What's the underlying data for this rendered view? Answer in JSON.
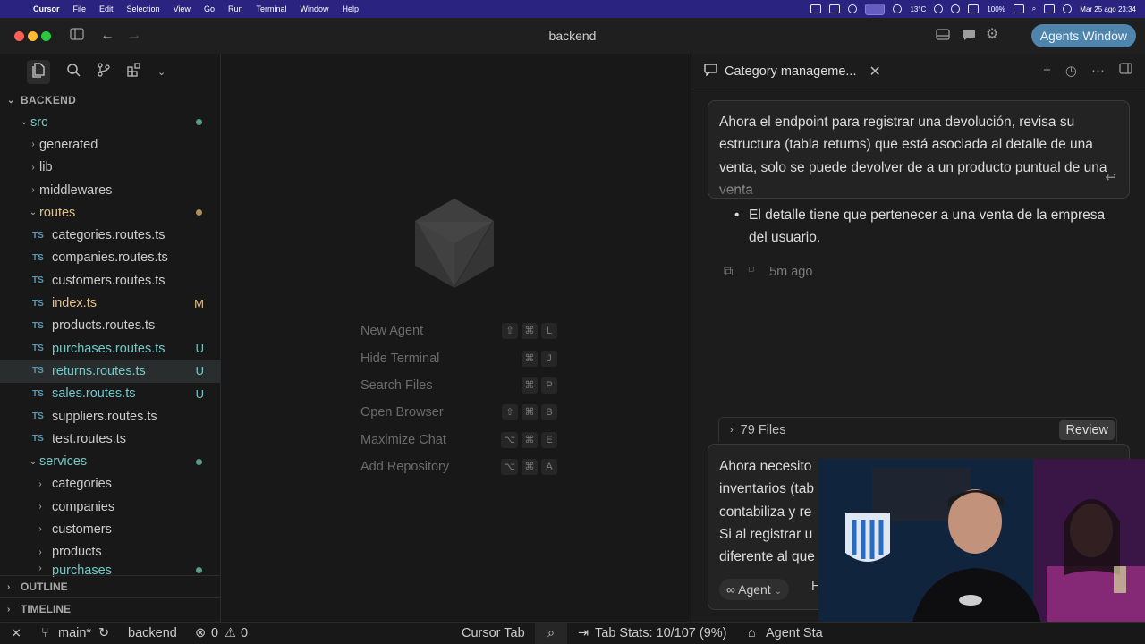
{
  "menubar": {
    "app": "Cursor",
    "items": [
      "File",
      "Edit",
      "Selection",
      "View",
      "Go",
      "Run",
      "Terminal",
      "Window",
      "Help"
    ],
    "temperature": "13°C",
    "battery": "100%",
    "clock": "Mar 25 ago  23:34"
  },
  "titlebar": {
    "title": "backend",
    "agents_button": "Agents Window"
  },
  "sidebar": {
    "section": "BACKEND",
    "tree": [
      {
        "name": "src",
        "type": "folder",
        "open": true,
        "level": 0,
        "status": "dot-green"
      },
      {
        "name": "generated",
        "type": "folder",
        "open": false,
        "level": 1
      },
      {
        "name": "lib",
        "type": "folder",
        "open": false,
        "level": 1
      },
      {
        "name": "middlewares",
        "type": "folder",
        "open": false,
        "level": 1
      },
      {
        "name": "routes",
        "type": "folder",
        "open": true,
        "level": 1,
        "status": "dot-orange"
      },
      {
        "name": "categories.routes.ts",
        "type": "ts",
        "level": 2
      },
      {
        "name": "companies.routes.ts",
        "type": "ts",
        "level": 2
      },
      {
        "name": "customers.routes.ts",
        "type": "ts",
        "level": 2
      },
      {
        "name": "index.ts",
        "type": "ts",
        "level": 2,
        "badge": "M"
      },
      {
        "name": "products.routes.ts",
        "type": "ts",
        "level": 2
      },
      {
        "name": "purchases.routes.ts",
        "type": "ts",
        "level": 2,
        "badge": "U"
      },
      {
        "name": "returns.routes.ts",
        "type": "ts",
        "level": 2,
        "badge": "U",
        "selected": true
      },
      {
        "name": "sales.routes.ts",
        "type": "ts",
        "level": 2,
        "badge": "U"
      },
      {
        "name": "suppliers.routes.ts",
        "type": "ts",
        "level": 2
      },
      {
        "name": "test.routes.ts",
        "type": "ts",
        "level": 2
      },
      {
        "name": "services",
        "type": "folder",
        "open": true,
        "level": 1,
        "status": "dot-green"
      },
      {
        "name": "categories",
        "type": "folder",
        "open": false,
        "level": 2
      },
      {
        "name": "companies",
        "type": "folder",
        "open": false,
        "level": 2
      },
      {
        "name": "customers",
        "type": "folder",
        "open": false,
        "level": 2
      },
      {
        "name": "products",
        "type": "folder",
        "open": false,
        "level": 2
      },
      {
        "name": "purchases",
        "type": "folder",
        "open": false,
        "level": 2,
        "status": "dot-green"
      }
    ],
    "outline": "OUTLINE",
    "timeline": "TIMELINE"
  },
  "editor": {
    "commands": [
      {
        "label": "New Agent",
        "keys": [
          "⇧",
          "⌘",
          "L"
        ]
      },
      {
        "label": "Hide Terminal",
        "keys": [
          "⌘",
          "J"
        ]
      },
      {
        "label": "Search Files",
        "keys": [
          "⌘",
          "P"
        ]
      },
      {
        "label": "Open Browser",
        "keys": [
          "⇧",
          "⌘",
          "B"
        ]
      },
      {
        "label": "Maximize Chat",
        "keys": [
          "⌥",
          "⌘",
          "E"
        ]
      },
      {
        "label": "Add Repository",
        "keys": [
          "⌥",
          "⌘",
          "A"
        ]
      }
    ]
  },
  "chat": {
    "tab_title": "Category manageme...",
    "user_message": "Ahora el endpoint para registrar una devolución, revisa su estructura (tabla returns) que está asociada al detalle de una venta, solo se puede devolver de a un producto puntual de una venta",
    "bullet": "El detalle tiene que pertenecer a una venta de la empresa del usuario.",
    "timestamp": "5m ago",
    "files_count": "79 Files",
    "review_label": "Review",
    "input_lines": [
      "Ahora necesito",
      "inventarios (tab",
      "contabiliza y re",
      "Si al registrar u",
      "diferente al que"
    ],
    "mode": "Agent",
    "next_fragment": "H"
  },
  "statusbar": {
    "branch": "main*",
    "workspace": "backend",
    "errors": "0",
    "warnings": "0",
    "cursor_tab": "Cursor Tab",
    "tab_stats": "Tab Stats: 10/107 (9%)",
    "agent_stats": "Agent Sta"
  }
}
